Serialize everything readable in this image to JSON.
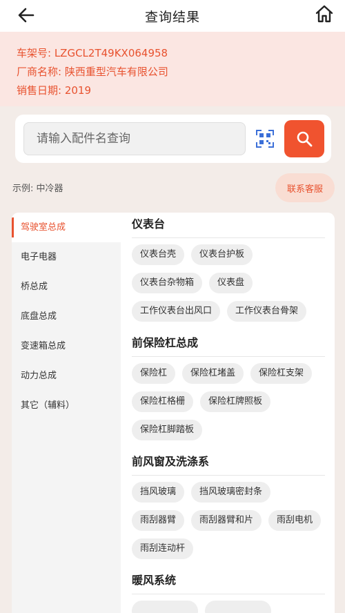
{
  "header": {
    "title": "查询结果"
  },
  "vehicle": {
    "vin_label": "车架号: LZGCL2T49KX064958",
    "maker_label": "厂商名称: 陕西重型汽车有限公司",
    "sale_date_label": "销售日期: 2019"
  },
  "search": {
    "placeholder": "请输入配件名查询"
  },
  "example_text": "示例: 中冷器",
  "service_button": "联系客服",
  "categories": [
    {
      "label": "驾驶室总成",
      "active": true
    },
    {
      "label": "电子电器"
    },
    {
      "label": "桥总成"
    },
    {
      "label": "底盘总成"
    },
    {
      "label": "变速箱总成"
    },
    {
      "label": "动力总成"
    },
    {
      "label": "其它（辅料）"
    }
  ],
  "sections": [
    {
      "title": "仪表台",
      "tags": [
        "仪表台壳",
        "仪表台护板",
        "仪表台杂物箱",
        "仪表盘",
        "工作仪表台出风口",
        "工作仪表台骨架"
      ]
    },
    {
      "title": "前保险杠总成",
      "tags": [
        "保险杠",
        "保险杠堵盖",
        "保险杠支架",
        "保险杠格栅",
        "保险杠牌照板",
        "保险杠脚踏板"
      ]
    },
    {
      "title": "前风窗及洗涤系",
      "tags": [
        "挡风玻璃",
        "挡风玻璃密封条",
        "雨刮器臂",
        "雨刮器臂和片",
        "雨刮电机",
        "雨刮连动杆"
      ]
    },
    {
      "title": "暖风系统",
      "tags": [
        "",
        ""
      ]
    }
  ],
  "colors": {
    "accent": "#f0532f",
    "info_bg": "#fbe6e2",
    "page_bg": "#f3ece8"
  },
  "icons": {
    "back": "arrow-left-icon",
    "home": "home-icon",
    "scan": "scan-qr-icon",
    "search": "search-icon"
  }
}
